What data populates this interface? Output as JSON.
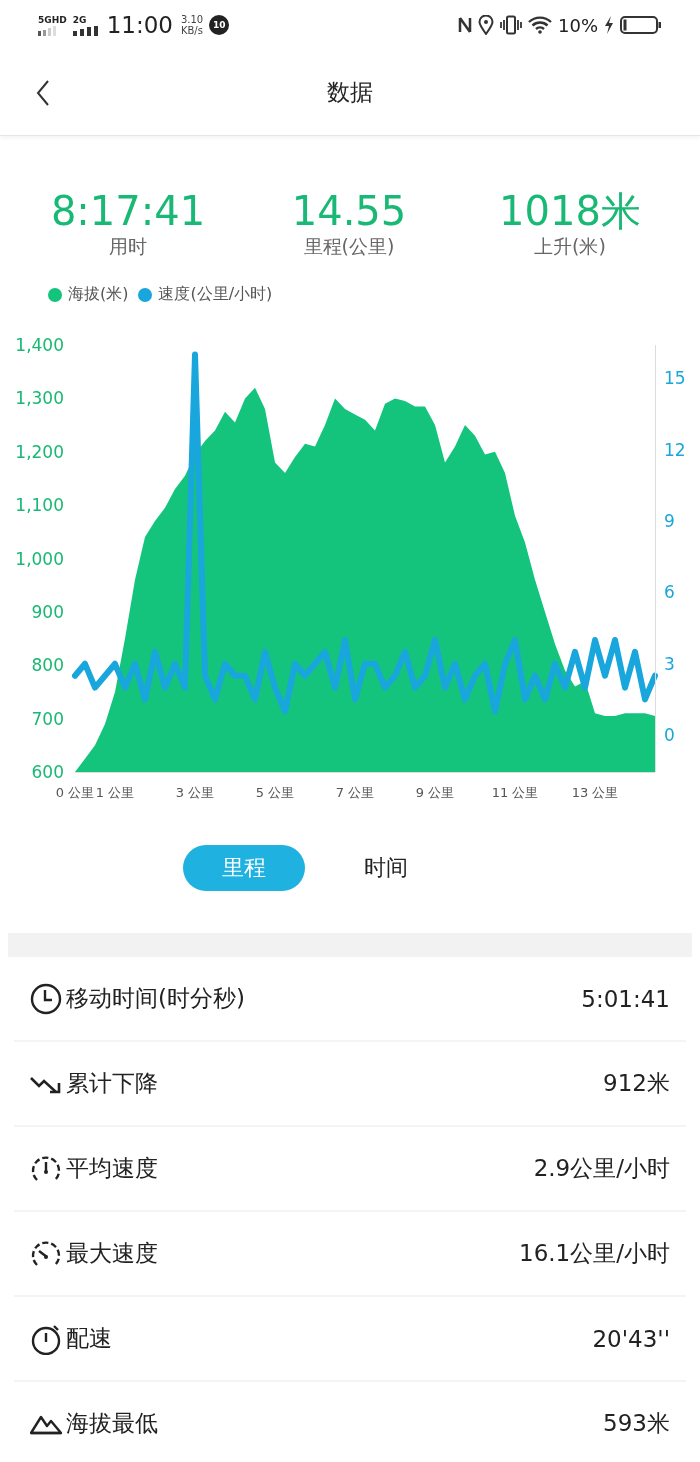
{
  "status_bar": {
    "network_1": "5GHD",
    "network_2": "2G",
    "time": "11:00",
    "speed_value": "3.10",
    "speed_unit": "KB/s",
    "badge": "10",
    "battery": "10%"
  },
  "header": {
    "title": "数据"
  },
  "summary": [
    {
      "value": "8:17:41",
      "label": "用时"
    },
    {
      "value": "14.55",
      "label": "里程(公里)"
    },
    {
      "value": "1018米",
      "label": "上升(米)"
    }
  ],
  "chart": {
    "chart_data": {
      "type": "area",
      "xlim": [
        0,
        14.5
      ],
      "ylim": [
        600,
        1400
      ],
      "yticks": [
        {
          "value": 600,
          "label": "600"
        },
        {
          "value": 700,
          "label": "700"
        },
        {
          "value": 800,
          "label": "800"
        },
        {
          "value": 900,
          "label": "900"
        },
        {
          "value": 1000,
          "label": "1,000"
        },
        {
          "value": 1100,
          "label": "1,100"
        },
        {
          "value": 1200,
          "label": "1,200"
        },
        {
          "value": 1300,
          "label": "1,300"
        },
        {
          "value": 1400,
          "label": "1,400"
        }
      ],
      "y2lim": [
        -1.55,
        16.4
      ],
      "y2ticks": [
        0,
        3,
        6,
        9,
        12,
        15
      ],
      "xticks": [
        {
          "value": 0,
          "label": "0 公里"
        },
        {
          "value": 1,
          "label": "1 公里"
        },
        {
          "value": 3,
          "label": "3 公里"
        },
        {
          "value": 5,
          "label": "5 公里"
        },
        {
          "value": 7,
          "label": "7 公里"
        },
        {
          "value": 9,
          "label": "9 公里"
        },
        {
          "value": 11,
          "label": "11 公里"
        },
        {
          "value": 13,
          "label": "13 公里"
        }
      ],
      "x": [
        0,
        0.25,
        0.5,
        0.75,
        1,
        1.25,
        1.5,
        1.75,
        2,
        2.25,
        2.5,
        2.75,
        3,
        3.25,
        3.5,
        3.75,
        4,
        4.25,
        4.5,
        4.75,
        5,
        5.25,
        5.5,
        5.75,
        6,
        6.25,
        6.5,
        6.75,
        7,
        7.25,
        7.5,
        7.75,
        8,
        8.25,
        8.5,
        8.75,
        9,
        9.25,
        9.5,
        9.75,
        10,
        10.25,
        10.5,
        10.75,
        11,
        11.25,
        11.5,
        11.75,
        12,
        12.25,
        12.5,
        12.75,
        13,
        13.25,
        13.5,
        13.75,
        14,
        14.25,
        14.5
      ],
      "series": [
        {
          "name": "海拔(米)",
          "color": "#14c47d",
          "values": [
            600,
            625,
            650,
            690,
            750,
            850,
            960,
            1040,
            1070,
            1095,
            1130,
            1155,
            1195,
            1220,
            1240,
            1275,
            1255,
            1300,
            1320,
            1280,
            1180,
            1160,
            1190,
            1215,
            1210,
            1250,
            1300,
            1280,
            1270,
            1260,
            1240,
            1290,
            1300,
            1295,
            1285,
            1285,
            1250,
            1180,
            1210,
            1250,
            1230,
            1195,
            1200,
            1160,
            1080,
            1030,
            960,
            900,
            840,
            790,
            760,
            770,
            710,
            705,
            705,
            710,
            710,
            710,
            705
          ]
        },
        {
          "name": "速度(公里/小时)",
          "color": "#19a6dc",
          "type": "line",
          "axis": "y2",
          "values": [
            2.5,
            3,
            2,
            2.5,
            3,
            2,
            3,
            1.5,
            3.5,
            2,
            3,
            2,
            16,
            2.5,
            1.5,
            3,
            2.5,
            2.5,
            1.5,
            3.5,
            2,
            1,
            3,
            2.5,
            3,
            3.5,
            2,
            4,
            1.5,
            3,
            3,
            2,
            2.5,
            3.5,
            2,
            2.5,
            4,
            2,
            3,
            1.5,
            2.5,
            3,
            1,
            3,
            4,
            1.5,
            2.5,
            1.5,
            3,
            2,
            3.5,
            2,
            4,
            2.5,
            4,
            2,
            3.5,
            1.5,
            2.5
          ]
        }
      ]
    }
  },
  "tabs": [
    {
      "label": "里程",
      "selected": true
    },
    {
      "label": "时间",
      "selected": false
    }
  ],
  "stats": [
    {
      "kind": "clock",
      "label": "移动时间(时分秒)",
      "value": "5:01:41"
    },
    {
      "kind": "descent",
      "label": "累计下降",
      "value": "912米"
    },
    {
      "kind": "gauge_avg",
      "label": "平均速度",
      "value": "2.9公里/小时"
    },
    {
      "kind": "gauge_max",
      "label": "最大速度",
      "value": "16.1公里/小时"
    },
    {
      "kind": "stopwatch",
      "label": "配速",
      "value": "20'43''"
    },
    {
      "kind": "mountain",
      "label": "海拔最低",
      "value": "593米"
    }
  ]
}
